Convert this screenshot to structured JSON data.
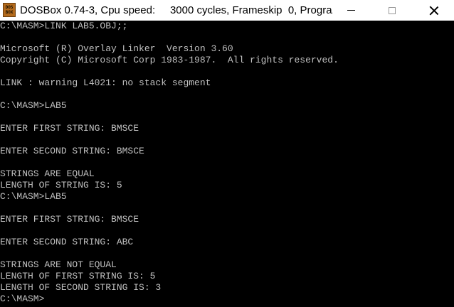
{
  "window": {
    "title": "DOSBox 0.74-3, Cpu speed:     3000 cycles, Frameskip  0, Progra...",
    "icon_text_top": "DOS",
    "icon_text_bottom": "BOX",
    "icons": {
      "app": "dosbox-icon",
      "minimize": "minimize-icon",
      "maximize": "maximize-icon",
      "close": "close-icon"
    }
  },
  "console": {
    "foreground": "#c0c0c0",
    "background": "#000000",
    "lines": [
      "C:\\MASM>LINK LAB5.OBJ;;",
      "",
      "Microsoft (R) Overlay Linker  Version 3.60",
      "Copyright (C) Microsoft Corp 1983-1987.  All rights reserved.",
      "",
      "LINK : warning L4021: no stack segment",
      "",
      "C:\\MASM>LAB5",
      "",
      "ENTER FIRST STRING: BMSCE",
      "",
      "ENTER SECOND STRING: BMSCE",
      "",
      "STRINGS ARE EQUAL",
      "LENGTH OF STRING IS: 5",
      "C:\\MASM>LAB5",
      "",
      "ENTER FIRST STRING: BMSCE",
      "",
      "ENTER SECOND STRING: ABC",
      "",
      "STRINGS ARE NOT EQUAL",
      "LENGTH OF FIRST STRING IS: 5",
      "LENGTH OF SECOND STRING IS: 3",
      "C:\\MASM>"
    ]
  }
}
